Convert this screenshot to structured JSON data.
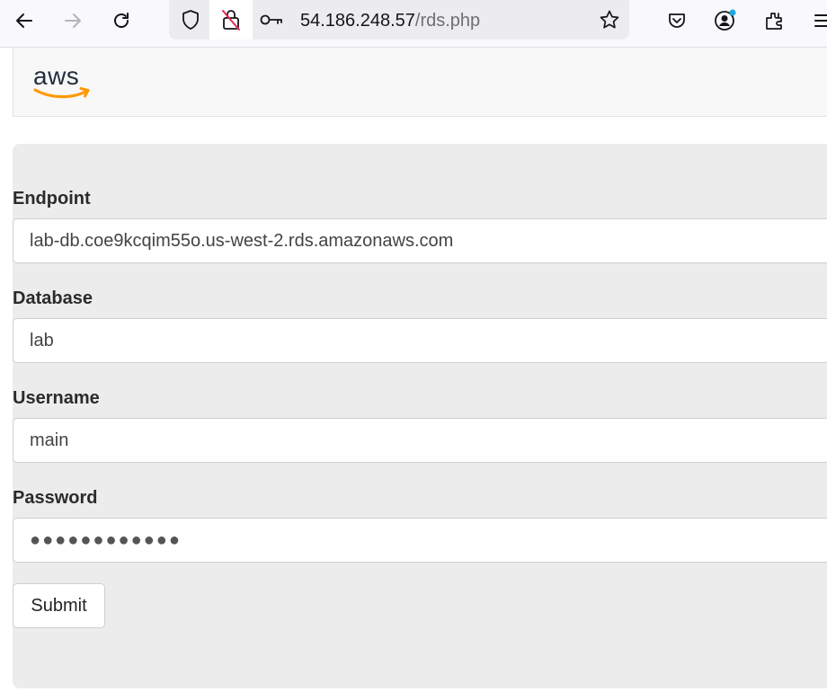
{
  "browser": {
    "url_host": "54.186.248.57",
    "url_path": "/rds.php",
    "icons": [
      "back-icon",
      "forward-icon",
      "reload-icon",
      "shield-icon",
      "insecure-lock-icon",
      "key-icon",
      "star-icon",
      "pocket-icon",
      "account-icon",
      "extensions-icon",
      "menu-icon"
    ]
  },
  "header": {
    "logo_text": "aws",
    "logo_colors": {
      "text": "#232f3e",
      "smile": "#ff9900"
    }
  },
  "form": {
    "fields": [
      {
        "label": "Endpoint",
        "value": "lab-db.coe9kcqim55o.us-west-2.rds.amazonaws.com"
      },
      {
        "label": "Database",
        "value": "lab"
      },
      {
        "label": "Username",
        "value": "main"
      },
      {
        "label": "Password",
        "value": "●●●●●●●●●●●●"
      }
    ],
    "submit_label": "Submit"
  },
  "colors": {
    "panel_bg": "#ececec",
    "header_bg": "#f8f8f8",
    "notification_dot": "#21a7e0"
  }
}
